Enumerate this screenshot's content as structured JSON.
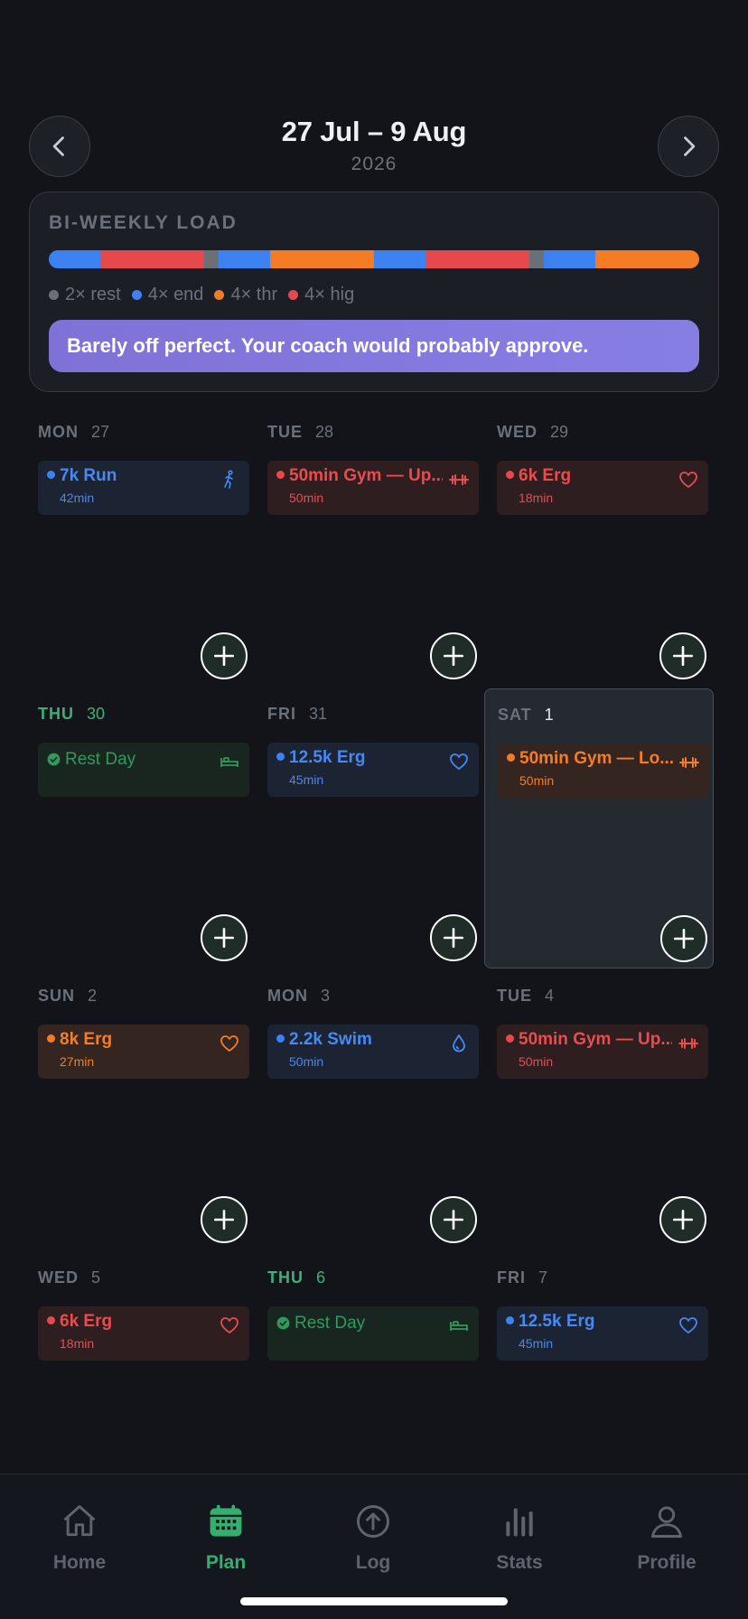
{
  "header": {
    "range": "27 Jul – 9 Aug",
    "year": "2026",
    "prev_icon": "chevron-left-icon",
    "next_icon": "chevron-right-icon"
  },
  "load": {
    "title": "BI-WEEKLY LOAD",
    "segments": [
      "end",
      "hig",
      "rest",
      "end",
      "thr",
      "end",
      "hig",
      "rest",
      "end",
      "thr"
    ],
    "colors": {
      "rest": "#6b7078",
      "end": "#3d82f0",
      "thr": "#f57b24",
      "hig": "#e7484b"
    },
    "legend": [
      {
        "key": "rest",
        "label": "2× rest"
      },
      {
        "key": "end",
        "label": "4× end"
      },
      {
        "key": "thr",
        "label": "4× thr"
      },
      {
        "key": "hig",
        "label": "4× hig"
      }
    ],
    "message": "Barely off perfect. Your coach would probably approve."
  },
  "days": [
    {
      "name": "MON",
      "num": "27",
      "activity": {
        "title": "7k Run",
        "duration": "42min",
        "color": "blue",
        "icon": "run-icon"
      }
    },
    {
      "name": "TUE",
      "num": "28",
      "activity": {
        "title": "50min Gym — Up...",
        "duration": "50min",
        "color": "red",
        "icon": "dumbbell-icon"
      }
    },
    {
      "name": "WED",
      "num": "29",
      "activity": {
        "title": "6k Erg",
        "duration": "18min",
        "color": "red",
        "icon": "heart-icon"
      }
    },
    {
      "name": "THU",
      "num": "30",
      "rest": true,
      "activity": {
        "title": "Rest Day",
        "color": "green",
        "icon": "bed-icon"
      }
    },
    {
      "name": "FRI",
      "num": "31",
      "activity": {
        "title": "12.5k Erg",
        "duration": "45min",
        "color": "blue",
        "icon": "heart-icon"
      }
    },
    {
      "name": "SAT",
      "num": "1",
      "today": true,
      "activity": {
        "title": "50min Gym — Lo...",
        "duration": "50min",
        "color": "orange",
        "icon": "dumbbell-icon"
      }
    },
    {
      "name": "SUN",
      "num": "2",
      "activity": {
        "title": "8k Erg",
        "duration": "27min",
        "color": "orange",
        "icon": "heart-icon"
      }
    },
    {
      "name": "MON",
      "num": "3",
      "activity": {
        "title": "2.2k Swim",
        "duration": "50min",
        "color": "blue",
        "icon": "drop-icon"
      }
    },
    {
      "name": "TUE",
      "num": "4",
      "activity": {
        "title": "50min Gym — Up...",
        "duration": "50min",
        "color": "red",
        "icon": "dumbbell-icon"
      }
    },
    {
      "name": "WED",
      "num": "5",
      "activity": {
        "title": "6k Erg",
        "duration": "18min",
        "color": "red",
        "icon": "heart-icon"
      }
    },
    {
      "name": "THU",
      "num": "6",
      "rest": true,
      "activity": {
        "title": "Rest Day",
        "color": "green",
        "icon": "bed-icon"
      }
    },
    {
      "name": "FRI",
      "num": "7",
      "activity": {
        "title": "12.5k Erg",
        "duration": "45min",
        "color": "blue",
        "icon": "heart-icon"
      }
    }
  ],
  "tabs": [
    {
      "label": "Home",
      "icon": "home-icon"
    },
    {
      "label": "Plan",
      "icon": "calendar-icon",
      "active": true
    },
    {
      "label": "Log",
      "icon": "upload-circle-icon"
    },
    {
      "label": "Stats",
      "icon": "bar-chart-icon"
    },
    {
      "label": "Profile",
      "icon": "user-icon"
    }
  ]
}
